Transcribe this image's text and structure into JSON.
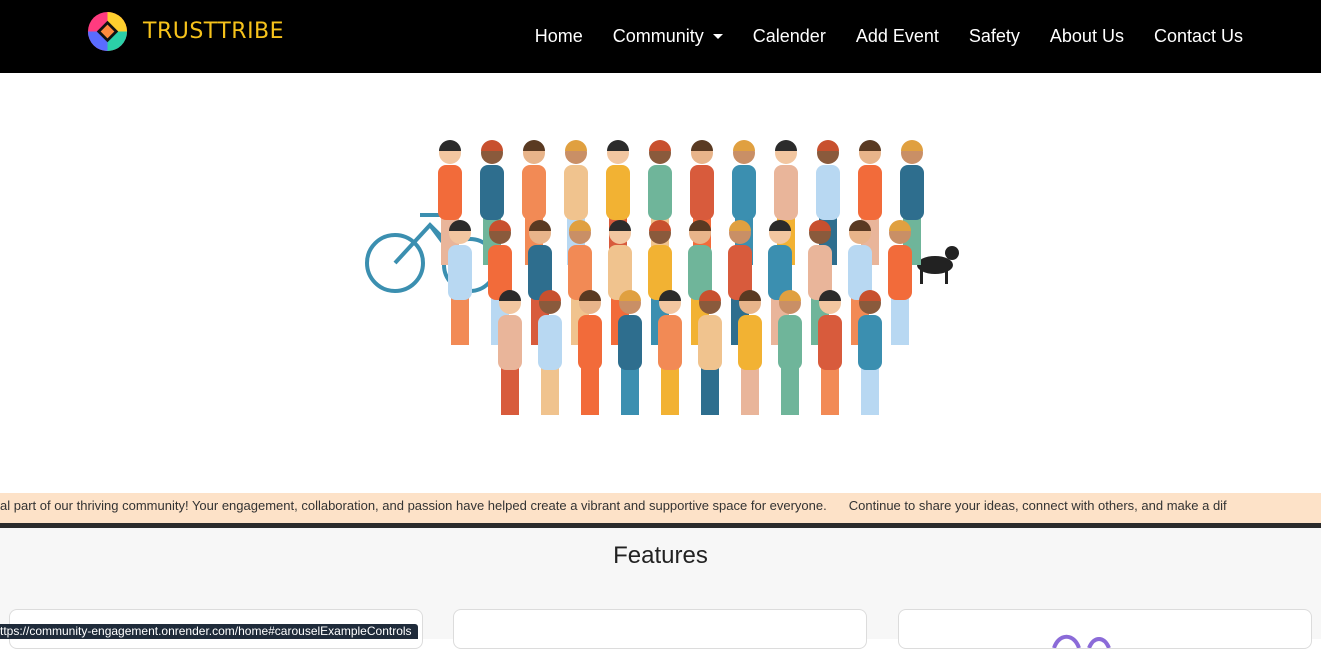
{
  "brand": {
    "name": "TRUSTTRIBE"
  },
  "nav": {
    "items": [
      {
        "label": "Home"
      },
      {
        "label": "Community"
      },
      {
        "label": "Calender"
      },
      {
        "label": "Add Event"
      },
      {
        "label": "Safety"
      },
      {
        "label": "About Us"
      },
      {
        "label": "Contact Us"
      }
    ]
  },
  "ticker": {
    "text1": "al part of our thriving community! Your engagement, collaboration, and passion have helped create a vibrant and supportive space for everyone.",
    "text2": "Continue to share your ideas, connect with others, and make a dif"
  },
  "features": {
    "title": "Features"
  },
  "status": {
    "url": "ttps://community-engagement.onrender.com/home#carouselExampleControls"
  },
  "colors": {
    "brand": "#f6c21b",
    "ticker_bg": "#fde2c8",
    "navbar": "#000000"
  }
}
